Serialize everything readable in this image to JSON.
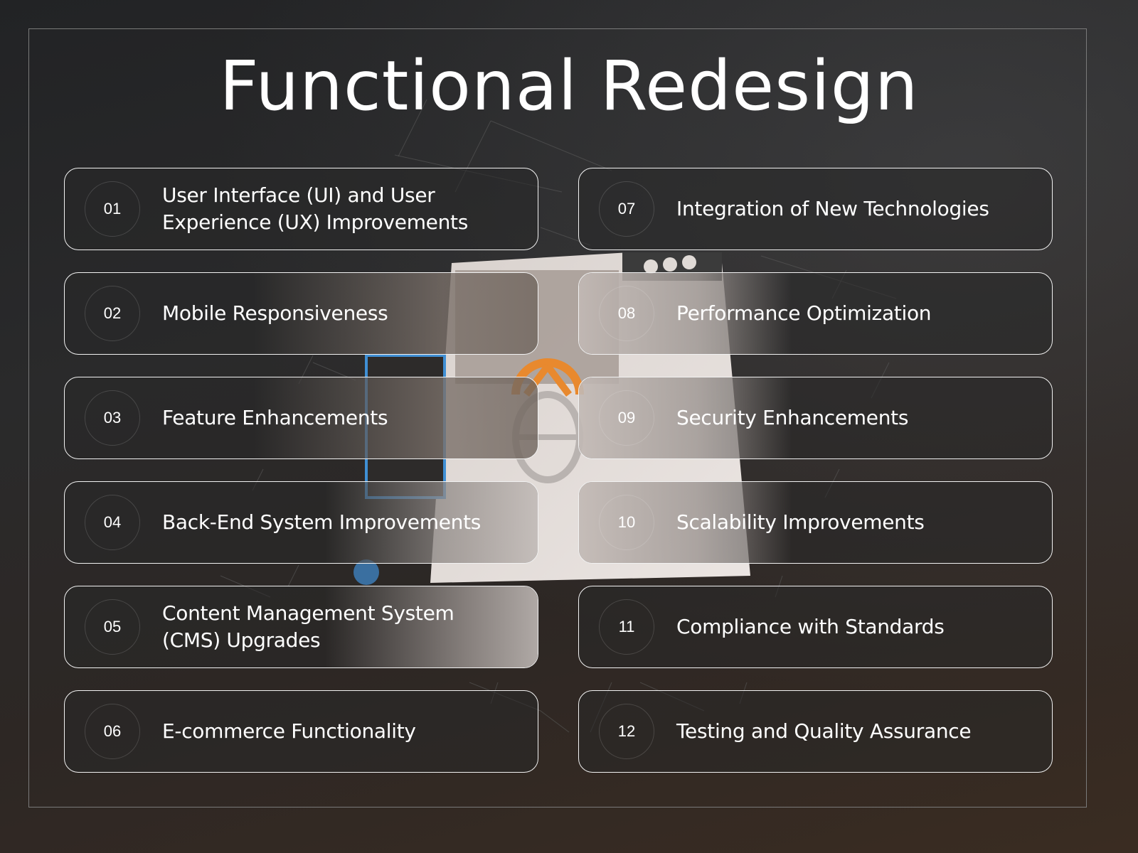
{
  "title": "Functional Redesign",
  "colors": {
    "background_top": "#222325",
    "background_bottom": "#3a2c22",
    "card_border": "#f2f2f2",
    "text": "#ffffff",
    "accent_orange": "#e8892e"
  },
  "items": [
    {
      "number": "01",
      "label": "User Interface (UI) and User Experience (UX) Improvements"
    },
    {
      "number": "02",
      "label": "Mobile Responsiveness"
    },
    {
      "number": "03",
      "label": "Feature Enhancements"
    },
    {
      "number": "04",
      "label": "Back-End System Improvements"
    },
    {
      "number": "05",
      "label": "Content Management System (CMS) Upgrades"
    },
    {
      "number": "06",
      "label": "E-commerce Functionality"
    },
    {
      "number": "07",
      "label": "Integration of New Technologies"
    },
    {
      "number": "08",
      "label": "Performance Optimization"
    },
    {
      "number": "09",
      "label": "Security Enhancements"
    },
    {
      "number": "10",
      "label": "Scalability Improvements"
    },
    {
      "number": "11",
      "label": "Compliance with Standards"
    },
    {
      "number": "12",
      "label": "Testing and Quality Assurance"
    }
  ]
}
